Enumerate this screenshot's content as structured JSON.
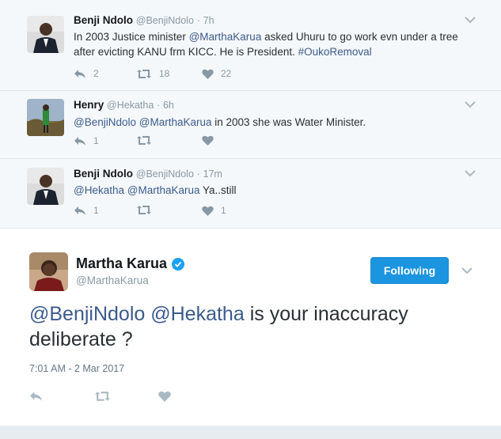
{
  "thread": [
    {
      "name": "Benji Ndolo",
      "handle": "@BenjiNdolo",
      "time": "7h",
      "body": [
        {
          "t": "In 2003 Justice minister ",
          "m": false
        },
        {
          "t": "@MarthaKarua",
          "m": true
        },
        {
          "t": " asked Uhuru to go work evn under a tree after evicting KANU frm KICC. He is President. ",
          "m": false
        },
        {
          "t": "#OukoRemoval",
          "m": true
        }
      ],
      "replies": "2",
      "retweets": "18",
      "likes": "22"
    },
    {
      "name": "Henry",
      "handle": "@Hekatha",
      "time": "6h",
      "body": [
        {
          "t": "@BenjiNdolo",
          "m": true
        },
        {
          "t": " ",
          "m": false
        },
        {
          "t": "@MarthaKarua",
          "m": true
        },
        {
          "t": " in 2003 she was Water Minister.",
          "m": false
        }
      ],
      "replies": "1",
      "retweets": "",
      "likes": ""
    },
    {
      "name": "Benji Ndolo",
      "handle": "@BenjiNdolo",
      "time": "17m",
      "body": [
        {
          "t": "@Hekatha",
          "m": true
        },
        {
          "t": " ",
          "m": false
        },
        {
          "t": "@MarthaKarua",
          "m": true
        },
        {
          "t": " Ya..still",
          "m": false
        }
      ],
      "replies": "1",
      "retweets": "",
      "likes": "1"
    }
  ],
  "main": {
    "name": "Martha Karua",
    "handle": "@MarthaKarua",
    "follow_label": "Following",
    "mention1": "@BenjiNdolo",
    "mention2": "@Hekatha",
    "text_rest": " is your inaccuracy deliberate ?",
    "date": "7:01 AM - 2 Mar 2017"
  },
  "dot": "·",
  "colors": {
    "accent": "#1b95e0",
    "mention": "#3b5b8b",
    "muted": "#8899a6",
    "thread_bg": "#f5f8fa"
  },
  "icons": {
    "reply": "reply-icon",
    "retweet": "retweet-icon",
    "like": "heart-icon",
    "more": "chevron-down-icon",
    "verified": "verified-badge-icon"
  }
}
